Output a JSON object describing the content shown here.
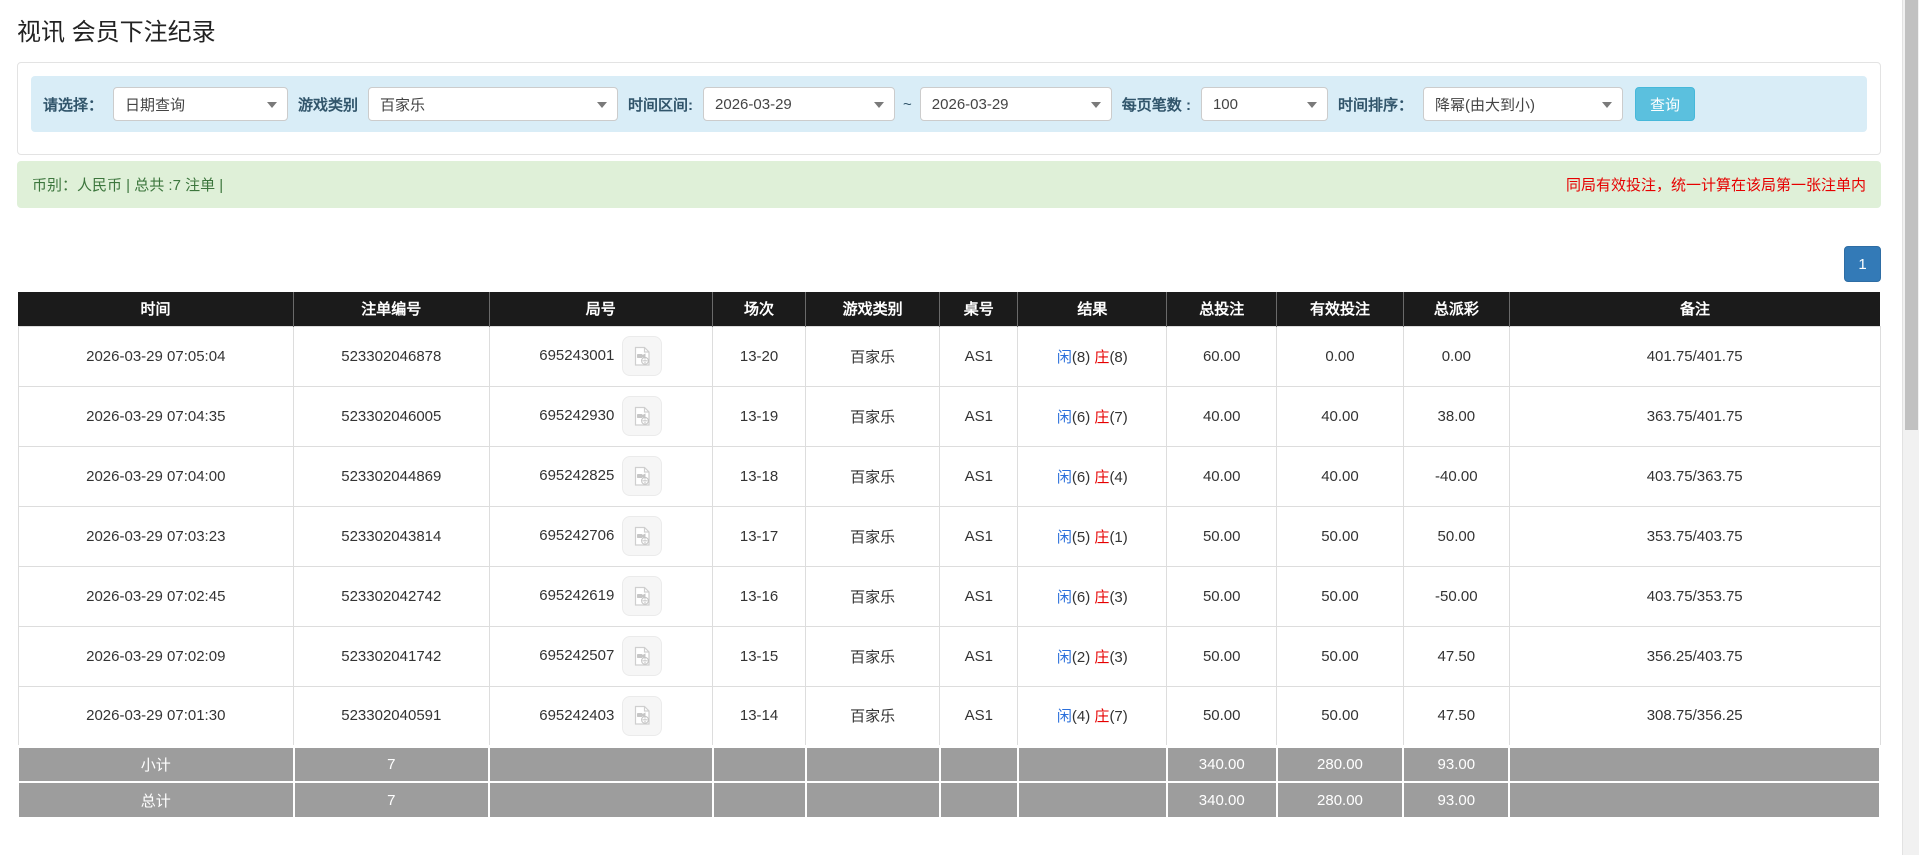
{
  "page": {
    "title": "视讯 会员下注纪录"
  },
  "filters": {
    "select_label": "请选择：",
    "select_value": "日期查询",
    "game_type_label": "游戏类别",
    "game_type_value": "百家乐",
    "time_range_label": "时间区间:",
    "date_from": "2026-03-29",
    "tilde": "~",
    "date_to": "2026-03-29",
    "page_size_label": "每页笔数 :",
    "page_size_value": "100",
    "sort_label": "时间排序：",
    "sort_value": "降幂(由大到小)",
    "search_button": "查询"
  },
  "summary_bar": {
    "left_text": "币别：人民币 | 总共 :7 注单 |",
    "right_note": "同局有效投注，统一计算在该局第一张注单内"
  },
  "pagination": {
    "current_page": "1"
  },
  "icons": {
    "video_button": "video-replay-icon",
    "dropdown": "chevron-down-icon"
  },
  "colors": {
    "filter_bar_bg": "#d9edf7",
    "search_button_bg": "#5bc0de",
    "success_bg": "#dff0d8",
    "success_text": "#3c763d",
    "note_red": "#e60000",
    "header_bg": "#1b1b1b",
    "summary_row_bg": "#9d9d9d",
    "pagination_blue": "#337ab7",
    "link_blue": "#2a6fdb",
    "player_blue": "#2a6fdb",
    "banker_red": "#e60000"
  },
  "table": {
    "headers": [
      "时间",
      "注单编号",
      "局号",
      "场次",
      "游戏类别",
      "桌号",
      "结果",
      "总投注",
      "有效投注",
      "总派彩",
      "备注"
    ],
    "rows": [
      {
        "time": "2026-03-29 07:05:04",
        "bet_id": "523302046878",
        "round_id": "695243001",
        "session": "13-20",
        "game_type": "百家乐",
        "table_no": "AS1",
        "result_p": "闲",
        "result_pv": "(8)",
        "result_b": "庄",
        "result_bv": "(8)",
        "total_bet": "60.00",
        "valid_bet": "0.00",
        "payout": "0.00",
        "note": "401.75/401.75"
      },
      {
        "time": "2026-03-29 07:04:35",
        "bet_id": "523302046005",
        "round_id": "695242930",
        "session": "13-19",
        "game_type": "百家乐",
        "table_no": "AS1",
        "result_p": "闲",
        "result_pv": "(6)",
        "result_b": "庄",
        "result_bv": "(7)",
        "total_bet": "40.00",
        "valid_bet": "40.00",
        "payout": "38.00",
        "note": "363.75/401.75"
      },
      {
        "time": "2026-03-29 07:04:00",
        "bet_id": "523302044869",
        "round_id": "695242825",
        "session": "13-18",
        "game_type": "百家乐",
        "table_no": "AS1",
        "result_p": "闲",
        "result_pv": "(6)",
        "result_b": "庄",
        "result_bv": "(4)",
        "total_bet": "40.00",
        "valid_bet": "40.00",
        "payout": "-40.00",
        "note": "403.75/363.75"
      },
      {
        "time": "2026-03-29 07:03:23",
        "bet_id": "523302043814",
        "round_id": "695242706",
        "session": "13-17",
        "game_type": "百家乐",
        "table_no": "AS1",
        "result_p": "闲",
        "result_pv": "(5)",
        "result_b": "庄",
        "result_bv": "(1)",
        "total_bet": "50.00",
        "valid_bet": "50.00",
        "payout": "50.00",
        "note": "353.75/403.75"
      },
      {
        "time": "2026-03-29 07:02:45",
        "bet_id": "523302042742",
        "round_id": "695242619",
        "session": "13-16",
        "game_type": "百家乐",
        "table_no": "AS1",
        "result_p": "闲",
        "result_pv": "(6)",
        "result_b": "庄",
        "result_bv": "(3)",
        "total_bet": "50.00",
        "valid_bet": "50.00",
        "payout": "-50.00",
        "note": "403.75/353.75"
      },
      {
        "time": "2026-03-29 07:02:09",
        "bet_id": "523302041742",
        "round_id": "695242507",
        "session": "13-15",
        "game_type": "百家乐",
        "table_no": "AS1",
        "result_p": "闲",
        "result_pv": "(2)",
        "result_b": "庄",
        "result_bv": "(3)",
        "total_bet": "50.00",
        "valid_bet": "50.00",
        "payout": "47.50",
        "note": "356.25/403.75"
      },
      {
        "time": "2026-03-29 07:01:30",
        "bet_id": "523302040591",
        "round_id": "695242403",
        "session": "13-14",
        "game_type": "百家乐",
        "table_no": "AS1",
        "result_p": "闲",
        "result_pv": "(4)",
        "result_b": "庄",
        "result_bv": "(7)",
        "total_bet": "50.00",
        "valid_bet": "50.00",
        "payout": "47.50",
        "note": "308.75/356.25"
      }
    ],
    "subtotal": {
      "label": "小计",
      "count": "7",
      "total_bet": "340.00",
      "valid_bet": "280.00",
      "payout": "93.00"
    },
    "total": {
      "label": "总计",
      "count": "7",
      "total_bet": "340.00",
      "valid_bet": "280.00",
      "payout": "93.00"
    }
  }
}
